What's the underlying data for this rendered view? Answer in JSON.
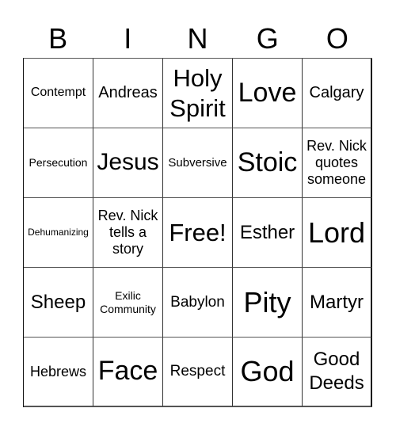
{
  "header": {
    "letters": [
      "B",
      "I",
      "N",
      "G",
      "O"
    ]
  },
  "card": {
    "free_space_label": "Free!",
    "rows": [
      [
        "Contempt",
        "Andreas",
        "Holy Spirit",
        "Love",
        "Calgary"
      ],
      [
        "Persecution",
        "Jesus",
        "Subversive",
        "Stoic",
        "Rev. Nick quotes someone"
      ],
      [
        "Dehumanizing",
        "Rev. Nick tells a story",
        "Free!",
        "Esther",
        "Lord"
      ],
      [
        "Sheep",
        "Exilic Community",
        "Babylon",
        "Pity",
        "Martyr"
      ],
      [
        "Hebrews",
        "Face",
        "Respect",
        "God",
        "Good Deeds"
      ]
    ]
  },
  "colors": {
    "background": "#ffffff",
    "text": "#000000",
    "grid_line": "#444444"
  }
}
